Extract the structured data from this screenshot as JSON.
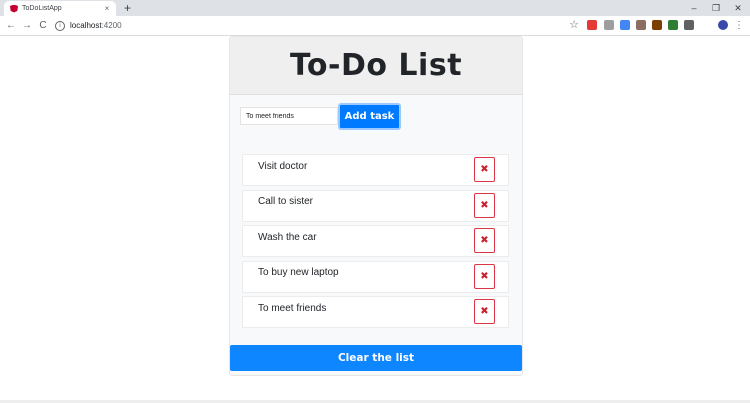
{
  "browser": {
    "tab_title": "ToDoListApp",
    "tab_close": "×",
    "new_tab": "+",
    "window_controls": {
      "minimize": "–",
      "restore": "❐",
      "close": "✕"
    },
    "nav": {
      "back": "←",
      "forward": "→",
      "reload": "C"
    },
    "url_host": "localhost",
    "url_port": ":4200",
    "star": "☆",
    "extension_colors": [
      "#e53935",
      "#9e9e9e",
      "#4285f4",
      "#8d6e63",
      "#7b3f00",
      "#2e7d32",
      "#616161",
      "#3949ab"
    ]
  },
  "app": {
    "title": "To-Do List",
    "input": {
      "value": "To meet friends",
      "placeholder": ""
    },
    "add_button": "Add task",
    "delete_symbol": "✖",
    "tasks": [
      {
        "label": "Visit doctor"
      },
      {
        "label": "Call to sister"
      },
      {
        "label": "Wash the car"
      },
      {
        "label": "To buy new laptop"
      },
      {
        "label": "To meet friends"
      }
    ],
    "clear_button": "Clear the list",
    "colors": {
      "primary": "#007bff",
      "danger": "#dc3545"
    }
  }
}
